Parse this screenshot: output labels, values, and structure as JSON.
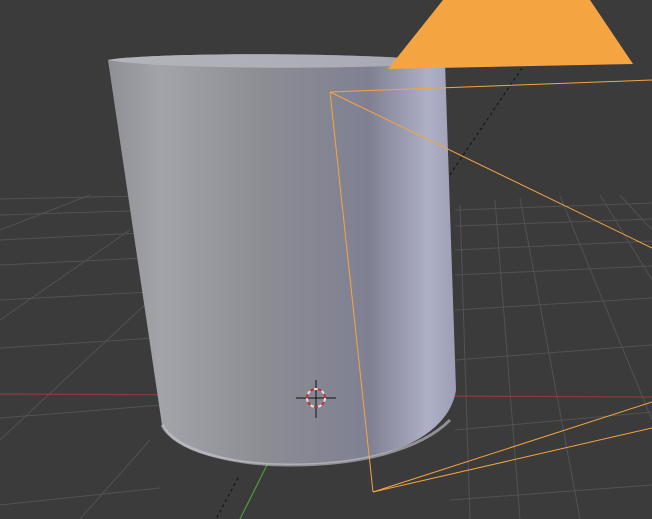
{
  "viewport": {
    "kind": "3D viewport",
    "background": "#3b3b3b",
    "grid_line_color": "#525252",
    "x_axis_color": "#8c3c3c",
    "y_axis_color": "#4f9a3b",
    "selection_color": "#f5a442"
  },
  "scene": {
    "objects": [
      {
        "name": "cylinder",
        "selected": false
      },
      {
        "name": "camera",
        "selected": true
      }
    ],
    "cursor_icon": "3d-cursor-icon"
  }
}
